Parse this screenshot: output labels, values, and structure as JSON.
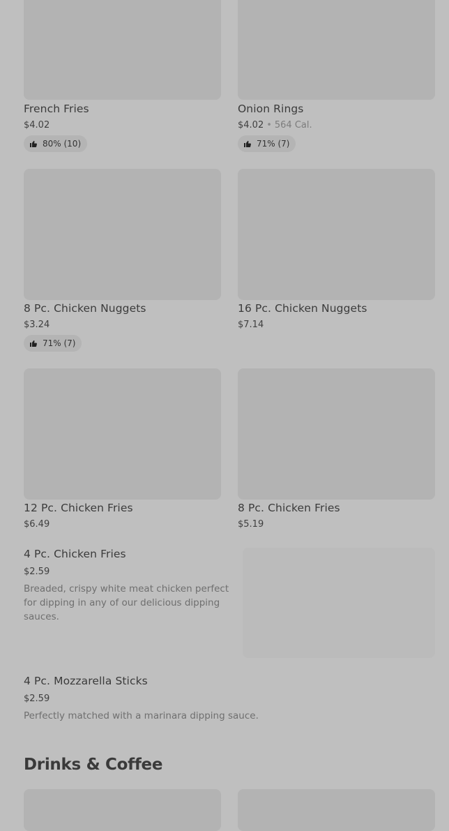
{
  "items": [
    {
      "name": "French Fries",
      "price": "$4.02",
      "rating": "80% (10)"
    },
    {
      "name": "Onion Rings",
      "price": "$4.02",
      "calories": "564 Cal.",
      "rating": "71% (7)"
    },
    {
      "name": "8 Pc. Chicken Nuggets",
      "price": "$3.24",
      "rating": "71% (7)"
    },
    {
      "name": "16 Pc. Chicken Nuggets",
      "price": "$7.14"
    },
    {
      "name": "12 Pc. Chicken Fries",
      "price": "$6.49"
    },
    {
      "name": "8 Pc. Chicken Fries",
      "price": "$5.19"
    }
  ],
  "list_items": [
    {
      "name": "4 Pc. Chicken Fries",
      "price": "$2.59",
      "description": "Breaded, crispy white meat chicken perfect for dipping in any of our delicious dipping sauces."
    },
    {
      "name": "4 Pc. Mozzarella Sticks",
      "price": "$2.59",
      "description": "Perfectly matched with a marinara dipping sauce."
    }
  ],
  "sections": {
    "drinks_title": "Drinks & Coffee"
  },
  "icons": {
    "rating": "thumbs-up-icon"
  },
  "colors": {
    "overlay": "#bfbfbf",
    "image_placeholder": "#b3b3b3"
  }
}
